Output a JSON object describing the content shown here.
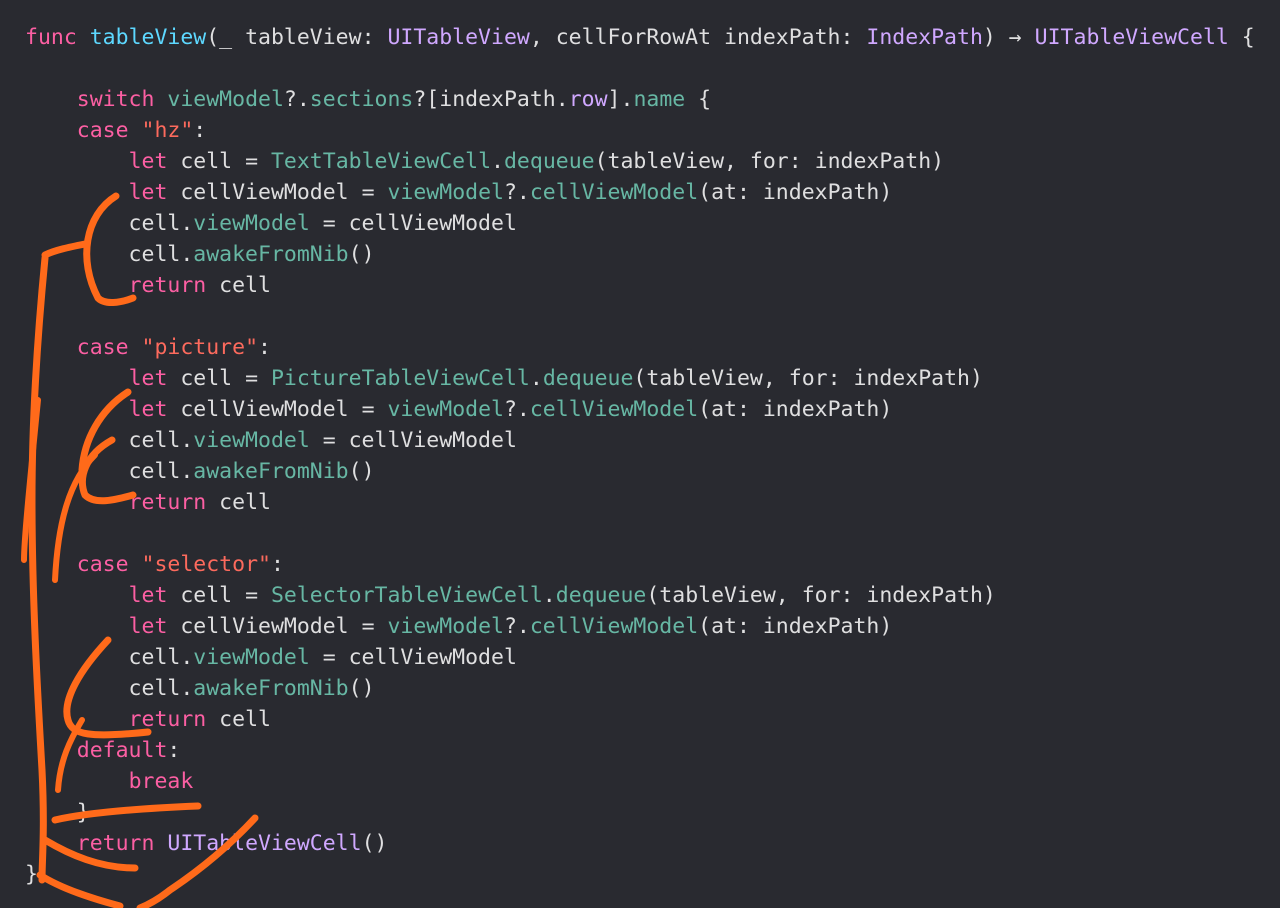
{
  "editor": {
    "background": "#292a30",
    "annotation_color": "#ff6a1a",
    "colors": {
      "kw": "#fc5fa3",
      "str": "#fc6a5d",
      "type": "#d0a8ff",
      "func": "#67b7a4",
      "var": "#67b7a4",
      "typedecl": "#5dd8ff",
      "plain": "#dfdfe0"
    },
    "lines": [
      [
        [
          "kw",
          "func"
        ],
        [
          "plain",
          " "
        ],
        [
          "typedecl",
          "tableView"
        ],
        [
          "plain",
          "(_ tableView: "
        ],
        [
          "type",
          "UITableView"
        ],
        [
          "plain",
          ", cellForRowAt indexPath: "
        ],
        [
          "type",
          "IndexPath"
        ],
        [
          "plain",
          ") → "
        ],
        [
          "type",
          "UITableViewCell"
        ],
        [
          "plain",
          " {"
        ]
      ],
      [],
      [
        [
          "plain",
          "    "
        ],
        [
          "kw",
          "switch"
        ],
        [
          "plain",
          " "
        ],
        [
          "var",
          "viewModel"
        ],
        [
          "plain",
          "?."
        ],
        [
          "var",
          "sections"
        ],
        [
          "plain",
          "?[indexPath."
        ],
        [
          "type",
          "row"
        ],
        [
          "plain",
          "]."
        ],
        [
          "var",
          "name"
        ],
        [
          "plain",
          " {"
        ]
      ],
      [
        [
          "plain",
          "    "
        ],
        [
          "kw",
          "case"
        ],
        [
          "plain",
          " "
        ],
        [
          "str",
          "\"hz\""
        ],
        [
          "plain",
          ":"
        ]
      ],
      [
        [
          "plain",
          "        "
        ],
        [
          "kw",
          "let"
        ],
        [
          "plain",
          " cell = "
        ],
        [
          "func",
          "TextTableViewCell"
        ],
        [
          "plain",
          "."
        ],
        [
          "func",
          "dequeue"
        ],
        [
          "plain",
          "(tableView, for: indexPath)"
        ]
      ],
      [
        [
          "plain",
          "        "
        ],
        [
          "kw",
          "let"
        ],
        [
          "plain",
          " cellViewModel = "
        ],
        [
          "var",
          "viewModel"
        ],
        [
          "plain",
          "?."
        ],
        [
          "func",
          "cellViewModel"
        ],
        [
          "plain",
          "(at: indexPath)"
        ]
      ],
      [
        [
          "plain",
          "        cell."
        ],
        [
          "var",
          "viewModel"
        ],
        [
          "plain",
          " = cellViewModel"
        ]
      ],
      [
        [
          "plain",
          "        cell."
        ],
        [
          "func",
          "awakeFromNib"
        ],
        [
          "plain",
          "()"
        ]
      ],
      [
        [
          "plain",
          "        "
        ],
        [
          "kw",
          "return"
        ],
        [
          "plain",
          " cell"
        ]
      ],
      [],
      [
        [
          "plain",
          "    "
        ],
        [
          "kw",
          "case"
        ],
        [
          "plain",
          " "
        ],
        [
          "str",
          "\"picture\""
        ],
        [
          "plain",
          ":"
        ]
      ],
      [
        [
          "plain",
          "        "
        ],
        [
          "kw",
          "let"
        ],
        [
          "plain",
          " cell = "
        ],
        [
          "func",
          "PictureTableViewCell"
        ],
        [
          "plain",
          "."
        ],
        [
          "func",
          "dequeue"
        ],
        [
          "plain",
          "(tableView, for: indexPath)"
        ]
      ],
      [
        [
          "plain",
          "        "
        ],
        [
          "kw",
          "let"
        ],
        [
          "plain",
          " cellViewModel = "
        ],
        [
          "var",
          "viewModel"
        ],
        [
          "plain",
          "?."
        ],
        [
          "func",
          "cellViewModel"
        ],
        [
          "plain",
          "(at: indexPath)"
        ]
      ],
      [
        [
          "plain",
          "        cell."
        ],
        [
          "var",
          "viewModel"
        ],
        [
          "plain",
          " = cellViewModel"
        ]
      ],
      [
        [
          "plain",
          "        cell."
        ],
        [
          "func",
          "awakeFromNib"
        ],
        [
          "plain",
          "()"
        ]
      ],
      [
        [
          "plain",
          "        "
        ],
        [
          "kw",
          "return"
        ],
        [
          "plain",
          " cell"
        ]
      ],
      [],
      [
        [
          "plain",
          "    "
        ],
        [
          "kw",
          "case"
        ],
        [
          "plain",
          " "
        ],
        [
          "str",
          "\"selector\""
        ],
        [
          "plain",
          ":"
        ]
      ],
      [
        [
          "plain",
          "        "
        ],
        [
          "kw",
          "let"
        ],
        [
          "plain",
          " cell = "
        ],
        [
          "func",
          "SelectorTableViewCell"
        ],
        [
          "plain",
          "."
        ],
        [
          "func",
          "dequeue"
        ],
        [
          "plain",
          "(tableView, for: indexPath)"
        ]
      ],
      [
        [
          "plain",
          "        "
        ],
        [
          "kw",
          "let"
        ],
        [
          "plain",
          " cellViewModel = "
        ],
        [
          "var",
          "viewModel"
        ],
        [
          "plain",
          "?."
        ],
        [
          "func",
          "cellViewModel"
        ],
        [
          "plain",
          "(at: indexPath)"
        ]
      ],
      [
        [
          "plain",
          "        cell."
        ],
        [
          "var",
          "viewModel"
        ],
        [
          "plain",
          " = cellViewModel"
        ]
      ],
      [
        [
          "plain",
          "        cell."
        ],
        [
          "func",
          "awakeFromNib"
        ],
        [
          "plain",
          "()"
        ]
      ],
      [
        [
          "plain",
          "        "
        ],
        [
          "kw",
          "return"
        ],
        [
          "plain",
          " cell"
        ]
      ],
      [
        [
          "plain",
          "    "
        ],
        [
          "kw",
          "default"
        ],
        [
          "plain",
          ":"
        ]
      ],
      [
        [
          "plain",
          "        "
        ],
        [
          "kw",
          "break"
        ]
      ],
      [
        [
          "plain",
          "    }"
        ]
      ],
      [
        [
          "plain",
          "    "
        ],
        [
          "kw",
          "return"
        ],
        [
          "plain",
          " "
        ],
        [
          "type",
          "UITableViewCell"
        ],
        [
          "plain",
          "()"
        ]
      ],
      [
        [
          "plain",
          "}"
        ]
      ]
    ]
  }
}
